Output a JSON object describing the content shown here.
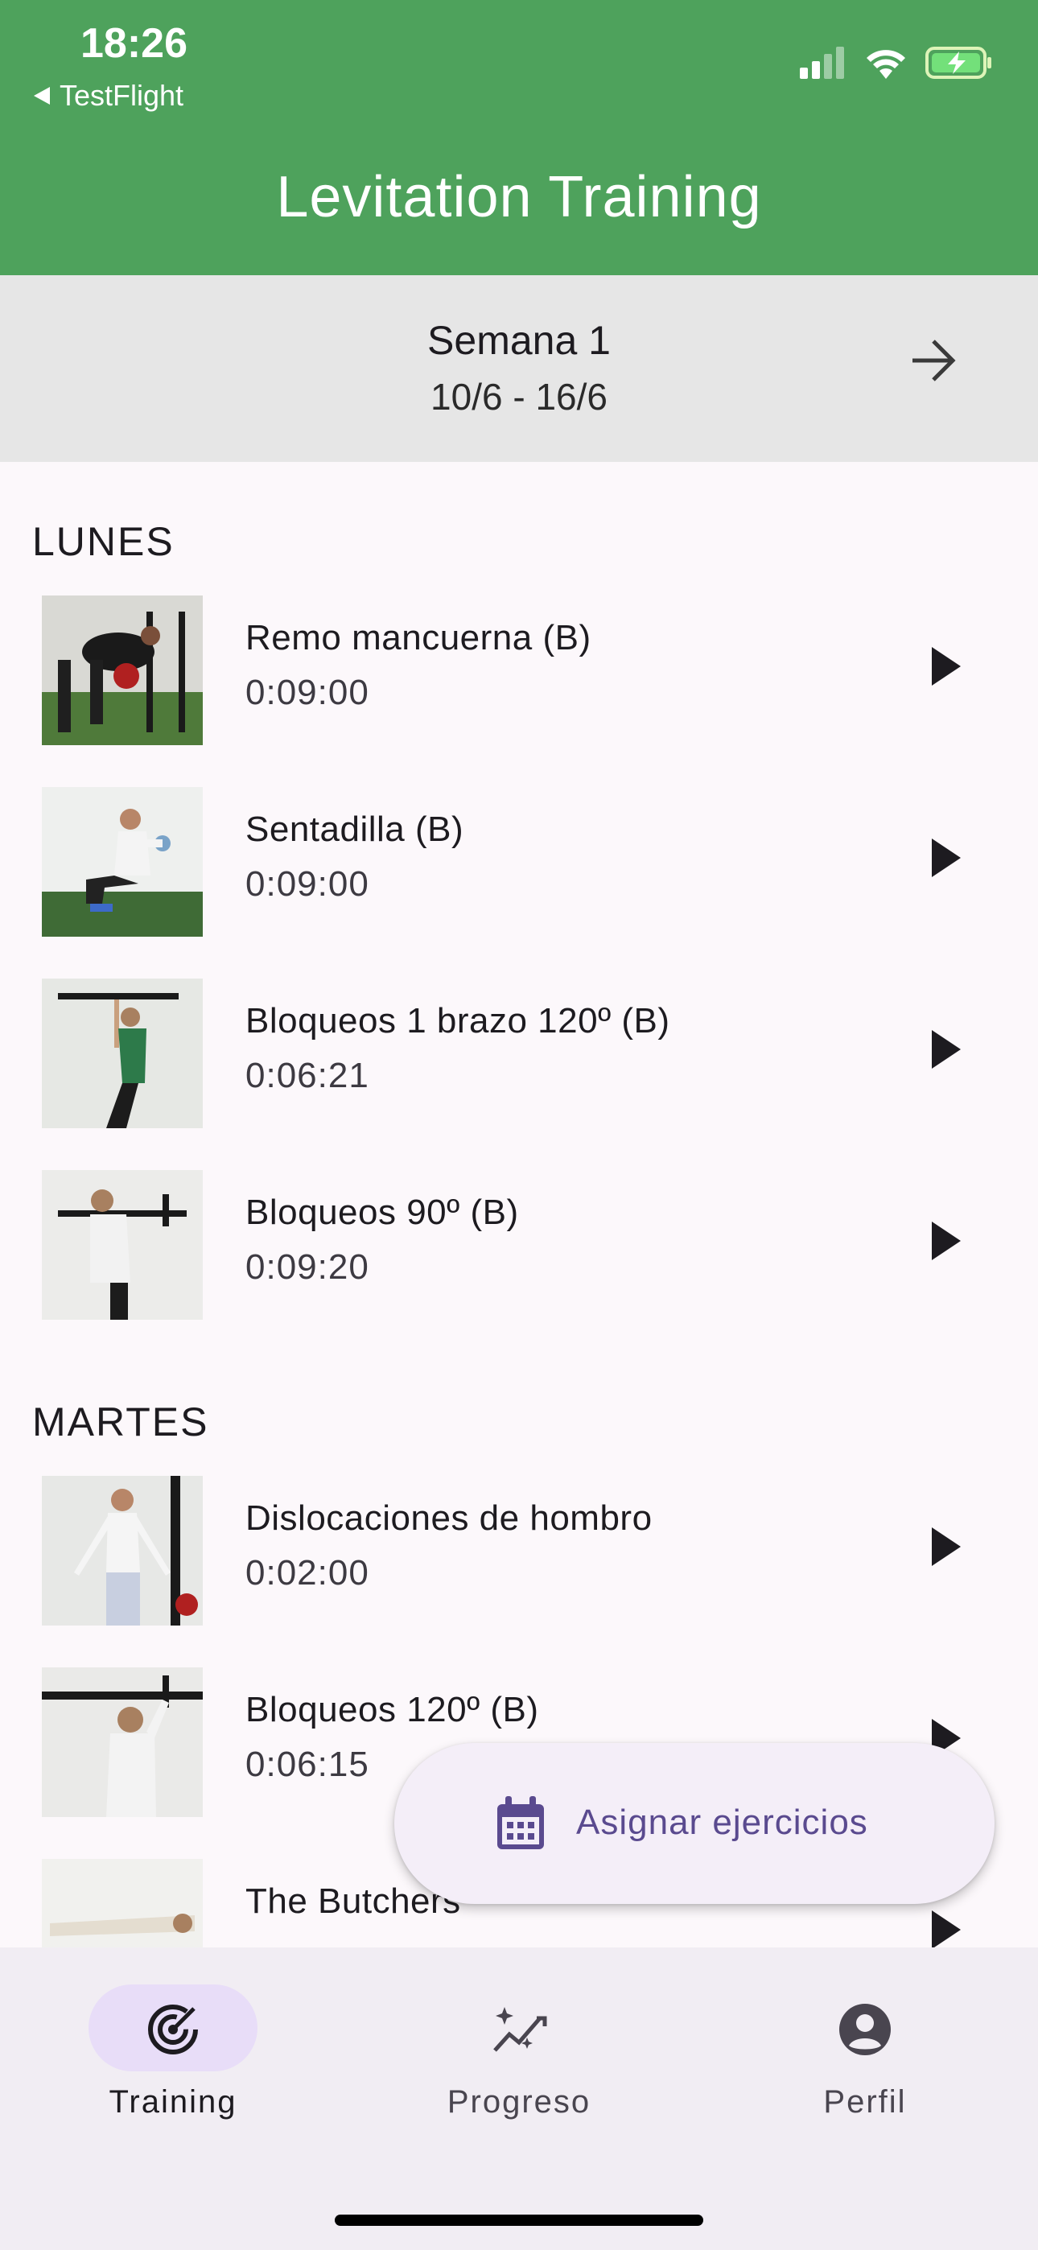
{
  "status_bar": {
    "time": "18:26",
    "back_app": "TestFlight",
    "icons": [
      "signal-icon",
      "wifi-icon",
      "battery-charging-icon"
    ]
  },
  "app_bar": {
    "title": "Levitation Training",
    "color": "#4EA25C"
  },
  "week": {
    "title": "Semana 1",
    "range": "10/6 - 16/6",
    "next_icon": "arrow-right-icon"
  },
  "days": [
    {
      "heading": "LUNES",
      "exercises": [
        {
          "name": "Remo mancuerna (B)",
          "duration": "0:09:00"
        },
        {
          "name": "Sentadilla (B)",
          "duration": "0:09:00"
        },
        {
          "name": "Bloqueos 1 brazo 120º (B)",
          "duration": "0:06:21"
        },
        {
          "name": "Bloqueos 90º (B)",
          "duration": "0:09:20"
        }
      ]
    },
    {
      "heading": "MARTES",
      "exercises": [
        {
          "name": "Dislocaciones de hombro",
          "duration": "0:02:00"
        },
        {
          "name": "Bloqueos 120º (B)",
          "duration": "0:06:15"
        },
        {
          "name": "The Butchers",
          "duration": ""
        }
      ]
    }
  ],
  "fab": {
    "label": "Asignar ejercicios",
    "icon": "calendar-icon",
    "accent": "#5A4A8F"
  },
  "bottom_nav": {
    "items": [
      {
        "label": "Training",
        "icon": "target-icon",
        "active": true
      },
      {
        "label": "Progreso",
        "icon": "sparkle-chart-icon",
        "active": false
      },
      {
        "label": "Perfil",
        "icon": "account-circle-icon",
        "active": false
      }
    ]
  }
}
